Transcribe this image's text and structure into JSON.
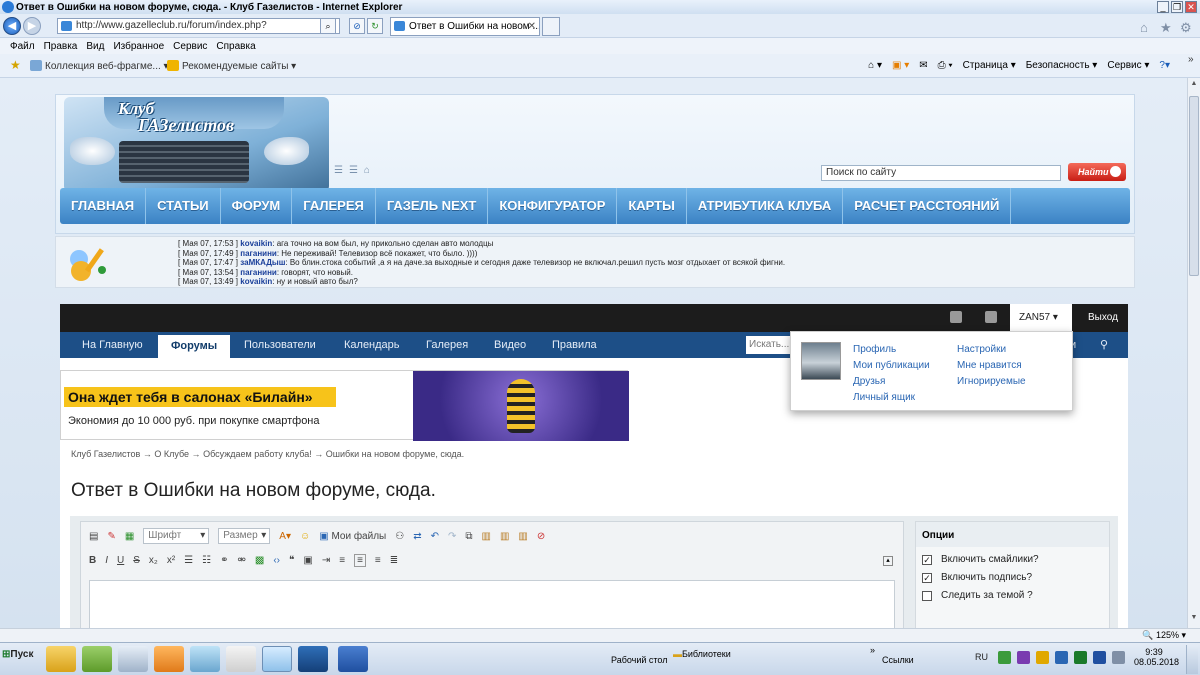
{
  "window": {
    "title": "Ответ в Ошибки на новом форуме, сюда. - Клуб Газелистов - Internet Explorer",
    "min": "_",
    "max": "❐",
    "close": "✕"
  },
  "address": {
    "url": "http://www.gazelleclub.ru/forum/index.php?",
    "tab_title": "Ответ в Ошибки на новом ...",
    "tab_close": "✕"
  },
  "menu": [
    "Файл",
    "Правка",
    "Вид",
    "Избранное",
    "Сервис",
    "Справка"
  ],
  "favorites": {
    "item1": "Коллекция веб-фрагме...",
    "item2": "Рекомендуемые сайты",
    "commands": [
      "Страница",
      "Безопасность",
      "Сервис"
    ]
  },
  "site": {
    "logo_line1": "Клуб",
    "logo_line2": "ГАЗелистов",
    "search_placeholder": "Поиск по сайту",
    "search_button": "Найти",
    "nav": [
      "ГЛАВНАЯ",
      "СТАТЬИ",
      "ФОРУМ",
      "ГАЛЕРЕЯ",
      "ГАЗЕЛЬ NEXT",
      "КОНФИГУРАТОР",
      "КАРТЫ",
      "АТРИБУТИКА КЛУБА",
      "РАСЧЕТ РАССТОЯНИЙ"
    ]
  },
  "shoutbox": [
    {
      "time": "[ Мая 07, 17:53 ]",
      "user": "kovaikin",
      "text": "ага точно на вом был, ну прикольно сделан авто молодцы"
    },
    {
      "time": "[ Мая 07, 17:49 ]",
      "user": "паганини",
      "text": "Не переживай! Телевизор всё покажет, что было. ))))"
    },
    {
      "time": "[ Мая 07, 17:47 ]",
      "user": "заМКАДыш",
      "text": "Во блин.стока событий ,а я на даче.за выходные и сегодня даже телевизор не включал.решил пусть мозг отдыхает от всякой фигни."
    },
    {
      "time": "[ Мая 07, 13:54 ]",
      "user": "паганини",
      "text": "говорят, что новый."
    },
    {
      "time": "[ Мая 07, 13:49 ]",
      "user": "kovaikin",
      "text": "ну и новый авто был?"
    }
  ],
  "forum": {
    "username": "ZAN57",
    "logout": "Выход",
    "tabs": [
      "На Главную",
      "Форумы",
      "Пользователи",
      "Календарь",
      "Галерея",
      "Видео",
      "Правила"
    ],
    "active_tab": "Форумы",
    "search_placeholder": "Искать...",
    "subnav_tail": "и",
    "dropdown": {
      "left": [
        "Профиль",
        "Мои публикации",
        "Друзья",
        "Личный ящик"
      ],
      "right": [
        "Настройки",
        "Мне нравится",
        "Игнорируемые"
      ]
    },
    "banner_title": "Она ждет тебя в салонах «Билайн»",
    "banner_sub": "Экономия до 10 000 руб. при покупке смартфона",
    "breadcrumb": [
      "Клуб Газелистов",
      "О Клубе",
      "Обсуждаем работу клуба!",
      "Ошибки на новом форуме, сюда."
    ],
    "breadcrumb_sep": "→",
    "page_title": "Ответ в Ошибки на новом форуме, сюда.",
    "editor": {
      "font": "Шрифт",
      "size": "Размер",
      "myfiles": "Мои файлы",
      "format": [
        "B",
        "I",
        "U",
        "S",
        "x₂",
        "x²"
      ]
    },
    "options": {
      "title": "Опции",
      "items": [
        {
          "label": "Включить смайлики?",
          "checked": true
        },
        {
          "label": "Включить подпись?",
          "checked": true
        },
        {
          "label": "Следить за темой ?",
          "checked": false
        }
      ]
    }
  },
  "status": {
    "zoom": "125%"
  },
  "taskbar": {
    "start": "Пуск",
    "desktop": "Рабочий стол",
    "libraries": "Библиотеки",
    "links": "Ссылки",
    "lang": "RU",
    "time": "9:39",
    "date": "08.05.2018",
    "chevron": "»"
  }
}
